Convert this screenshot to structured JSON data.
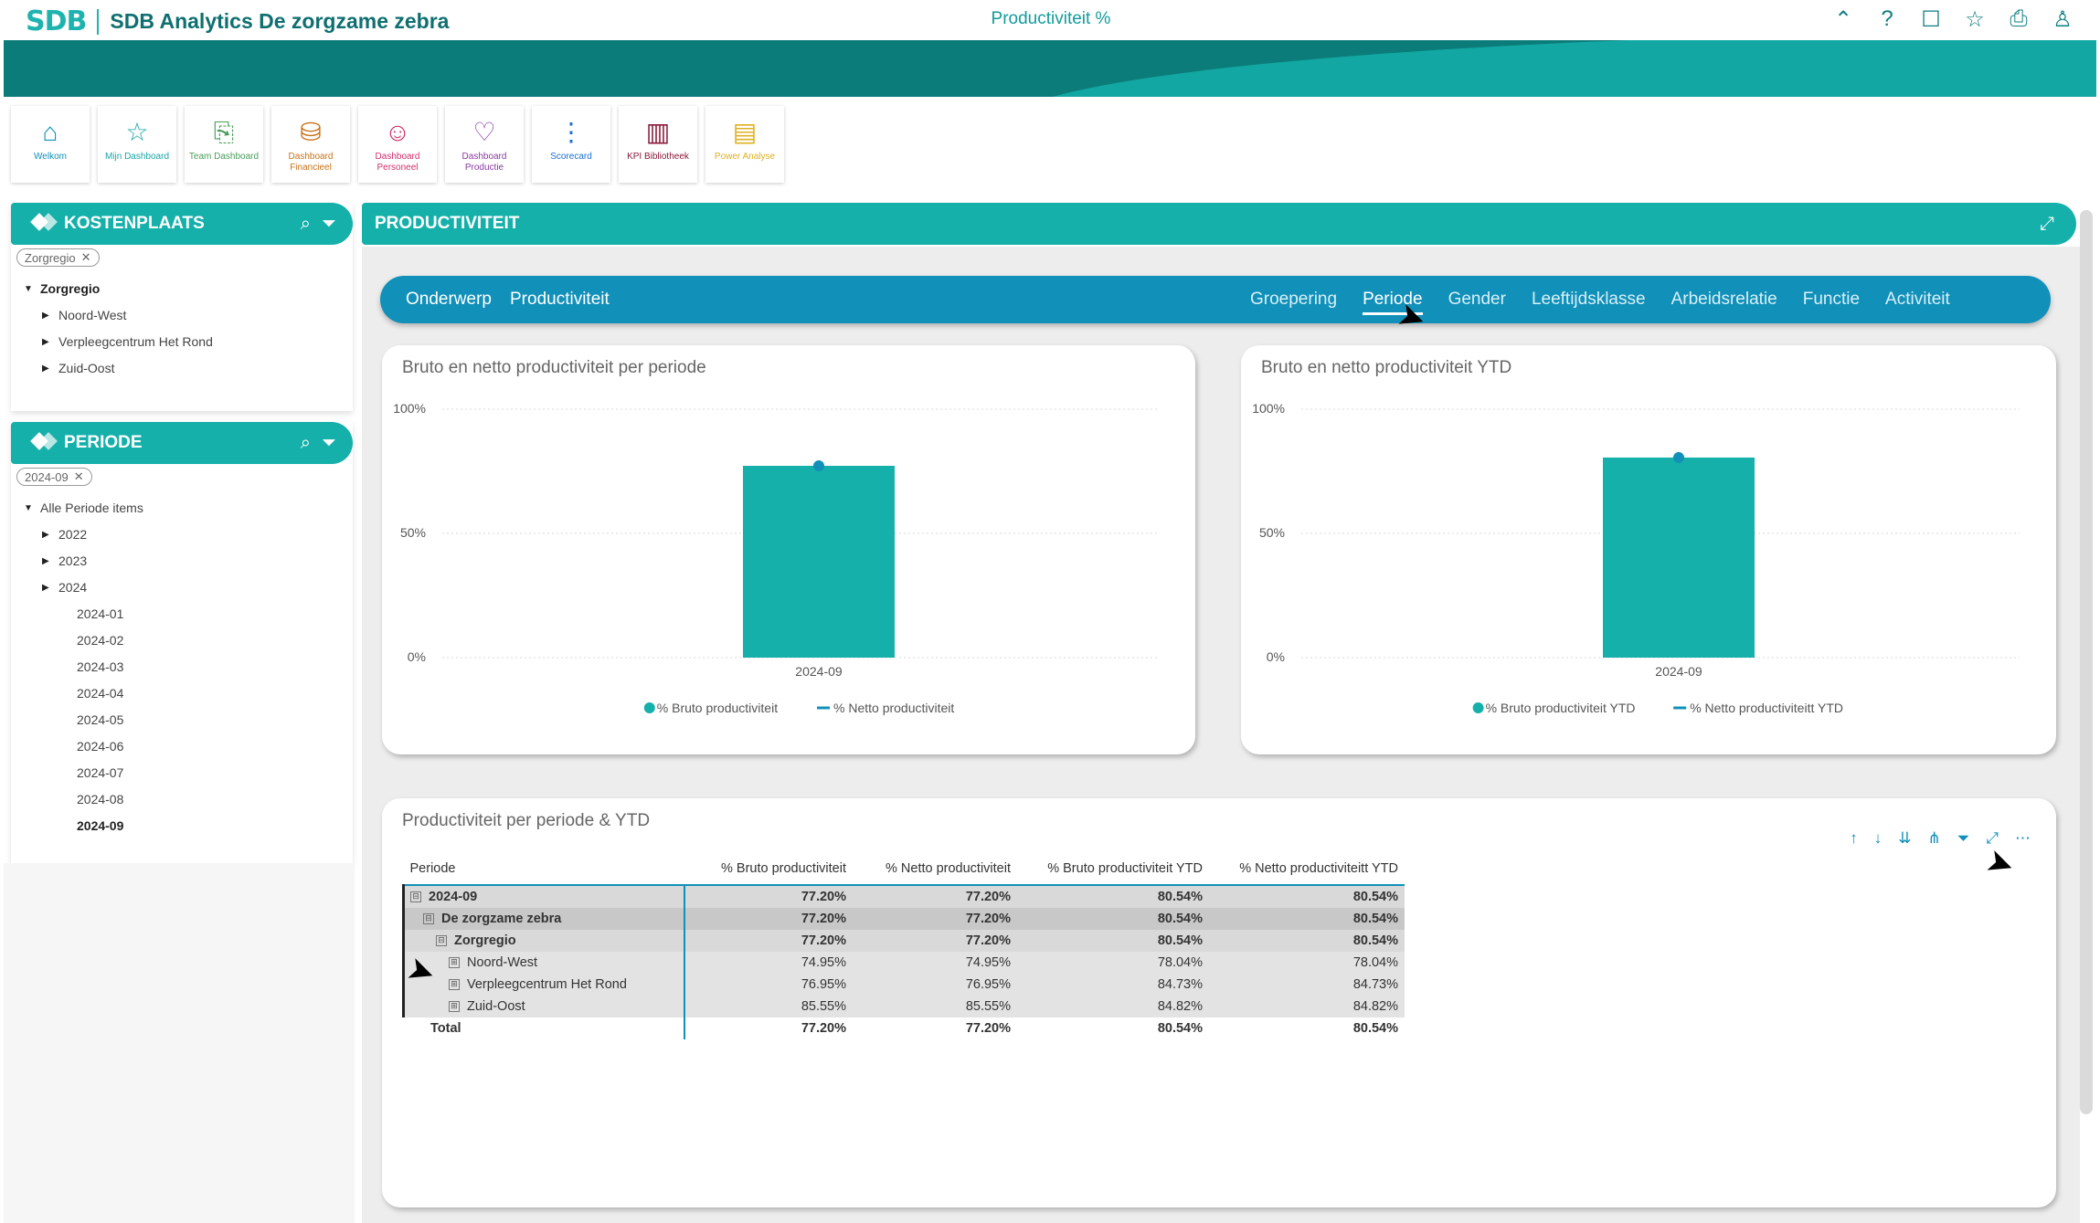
{
  "app": {
    "brand_logo": "SDB",
    "brand_title": "SDB Analytics De zorgzame zebra",
    "page_title": "Productiviteit %"
  },
  "top_icons": [
    {
      "name": "collapse-icon",
      "glyph": "⌃"
    },
    {
      "name": "help-icon",
      "glyph": "?"
    },
    {
      "name": "comment-icon",
      "glyph": "☐"
    },
    {
      "name": "star-icon",
      "glyph": "☆"
    },
    {
      "name": "print-icon",
      "glyph": "⎙"
    },
    {
      "name": "user-icon",
      "glyph": "♙"
    }
  ],
  "nav": [
    {
      "label": "Welkom",
      "icon": "home-icon",
      "glyph": "⌂",
      "color": "#1190b9"
    },
    {
      "label": "Mijn Dashboard",
      "icon": "star-icon",
      "glyph": "☆",
      "color": "#1aa6a6"
    },
    {
      "label": "Team Dashboard",
      "icon": "chart-icon",
      "glyph": "⎘",
      "color": "#4a9d5a"
    },
    {
      "label": "Dashboard Financieel",
      "icon": "coins-icon",
      "glyph": "⛁",
      "color": "#c8731a"
    },
    {
      "label": "Dashboard Personeel",
      "icon": "people-icon",
      "glyph": "☺",
      "color": "#d0306a"
    },
    {
      "label": "Dashboard Productie",
      "icon": "heart-hands-icon",
      "glyph": "♡",
      "color": "#8a3aa0"
    },
    {
      "label": "Scorecard",
      "icon": "traffic-light-icon",
      "glyph": "⋮",
      "color": "#1a6fd0"
    },
    {
      "label": "KPI Bibliotheek",
      "icon": "books-icon",
      "glyph": "▥",
      "color": "#8a1a3a"
    },
    {
      "label": "Power Analyse",
      "icon": "bars-icon",
      "glyph": "▤",
      "color": "#e0b020"
    }
  ],
  "kostenplaats": {
    "title": "KOSTENPLAATS",
    "chip": "Zorgregio",
    "tree": [
      {
        "label": "Zorgregio",
        "bold": true,
        "toggle": "▼",
        "indent": 0
      },
      {
        "label": "Noord-West",
        "bold": false,
        "toggle": "▶",
        "indent": 1
      },
      {
        "label": "Verpleegcentrum Het Rond",
        "bold": false,
        "toggle": "▶",
        "indent": 1
      },
      {
        "label": "Zuid-Oost",
        "bold": false,
        "toggle": "▶",
        "indent": 1
      }
    ]
  },
  "periode": {
    "title": "PERIODE",
    "chip": "2024-09",
    "tree": [
      {
        "label": "Alle Periode items",
        "bold": false,
        "toggle": "▼",
        "indent": 0
      },
      {
        "label": "2022",
        "bold": false,
        "toggle": "▶",
        "indent": 1
      },
      {
        "label": "2023",
        "bold": false,
        "toggle": "▶",
        "indent": 1
      },
      {
        "label": "2024",
        "bold": false,
        "toggle": "▶",
        "indent": 1
      },
      {
        "label": "2024-01",
        "bold": false,
        "toggle": "",
        "indent": 2
      },
      {
        "label": "2024-02",
        "bold": false,
        "toggle": "",
        "indent": 2
      },
      {
        "label": "2024-03",
        "bold": false,
        "toggle": "",
        "indent": 2
      },
      {
        "label": "2024-04",
        "bold": false,
        "toggle": "",
        "indent": 2
      },
      {
        "label": "2024-05",
        "bold": false,
        "toggle": "",
        "indent": 2
      },
      {
        "label": "2024-06",
        "bold": false,
        "toggle": "",
        "indent": 2
      },
      {
        "label": "2024-07",
        "bold": false,
        "toggle": "",
        "indent": 2
      },
      {
        "label": "2024-08",
        "bold": false,
        "toggle": "",
        "indent": 2
      },
      {
        "label": "2024-09",
        "bold": true,
        "toggle": "",
        "indent": 2
      }
    ]
  },
  "main": {
    "title": "PRODUCTIVITEIT",
    "subject_label": "Onderwerp",
    "subject_value": "Productiviteit",
    "tabs": [
      "Groepering",
      "Periode",
      "Gender",
      "Leeftijdsklasse",
      "Arbeidsrelatie",
      "Functie",
      "Activiteit"
    ],
    "active_tab": "Periode"
  },
  "chart_data": [
    {
      "type": "bar",
      "title": "Bruto en netto productiviteit per periode",
      "categories": [
        "2024-09"
      ],
      "series": [
        {
          "name": "% Bruto productiviteit",
          "kind": "bar",
          "values": [
            77.2
          ],
          "color": "#15b0aa"
        },
        {
          "name": "% Netto productiviteit",
          "kind": "line",
          "values": [
            77.2
          ],
          "color": "#1190b9"
        }
      ],
      "yticks": [
        "100%",
        "50%",
        "0%"
      ],
      "ylim": [
        0,
        100
      ],
      "legend": "bottom"
    },
    {
      "type": "bar",
      "title": "Bruto en netto productiviteit YTD",
      "categories": [
        "2024-09"
      ],
      "series": [
        {
          "name": "% Bruto productiviteit YTD",
          "kind": "bar",
          "values": [
            80.54
          ],
          "color": "#15b0aa"
        },
        {
          "name": "% Netto productiviteitt YTD",
          "kind": "line",
          "values": [
            80.54
          ],
          "color": "#1190b9"
        }
      ],
      "yticks": [
        "100%",
        "50%",
        "0%"
      ],
      "ylim": [
        0,
        100
      ],
      "legend": "bottom"
    }
  ],
  "table": {
    "title": "Productiviteit per periode & YTD",
    "columns": [
      "Periode",
      "% Bruto productiviteit",
      "% Netto productiviteit",
      "% Bruto productiviteit YTD",
      "% Netto productiviteitt YTD"
    ],
    "rows": [
      {
        "label": "2024-09",
        "level": 0,
        "toggle": "⊟",
        "values": [
          "77.20%",
          "77.20%",
          "80.54%",
          "80.54%"
        ]
      },
      {
        "label": "De zorgzame zebra",
        "level": 1,
        "toggle": "⊟",
        "values": [
          "77.20%",
          "77.20%",
          "80.54%",
          "80.54%"
        ]
      },
      {
        "label": "Zorgregio",
        "level": 2,
        "toggle": "⊟",
        "values": [
          "77.20%",
          "77.20%",
          "80.54%",
          "80.54%"
        ]
      },
      {
        "label": "Noord-West",
        "level": 3,
        "toggle": "⊞",
        "values": [
          "74.95%",
          "74.95%",
          "78.04%",
          "78.04%"
        ]
      },
      {
        "label": "Verpleegcentrum Het Rond",
        "level": 3,
        "toggle": "⊞",
        "values": [
          "76.95%",
          "76.95%",
          "84.73%",
          "84.73%"
        ]
      },
      {
        "label": "Zuid-Oost",
        "level": 3,
        "toggle": "⊞",
        "values": [
          "85.55%",
          "85.55%",
          "84.82%",
          "84.82%"
        ]
      },
      {
        "label": "Total",
        "level": "total",
        "toggle": "",
        "values": [
          "77.20%",
          "77.20%",
          "80.54%",
          "80.54%"
        ]
      }
    ],
    "tools": [
      {
        "name": "sort-up-icon",
        "glyph": "↑"
      },
      {
        "name": "sort-down-icon",
        "glyph": "↓"
      },
      {
        "name": "expand-all-icon",
        "glyph": "⇊"
      },
      {
        "name": "hierarchy-icon",
        "glyph": "⋔"
      },
      {
        "name": "filter-icon",
        "glyph": "⏷"
      },
      {
        "name": "focus-mode-icon",
        "glyph": "⤢"
      },
      {
        "name": "more-options-icon",
        "glyph": "⋯"
      }
    ]
  }
}
